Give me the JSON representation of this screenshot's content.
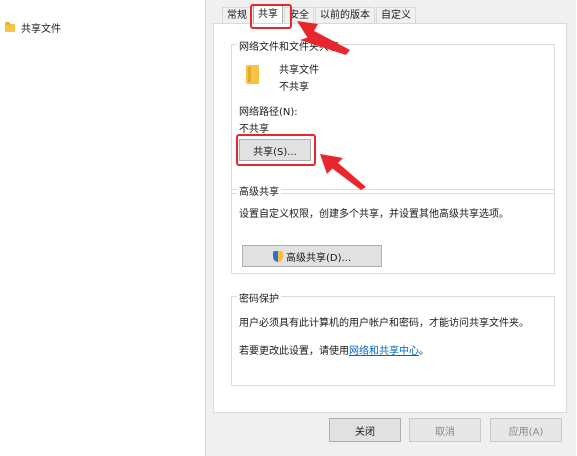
{
  "explorer": {
    "item_label": "共享文件"
  },
  "dialog": {
    "tabs": [
      {
        "label": "常规"
      },
      {
        "label": "共享"
      },
      {
        "label": "安全"
      },
      {
        "label": "以前的版本"
      },
      {
        "label": "自定义"
      }
    ],
    "network_share": {
      "group_title": "网络文件和文件夹共享",
      "folder_name": "共享文件",
      "folder_status": "不共享",
      "path_label": "网络路径(N):",
      "path_value": "不共享",
      "share_button": "共享(S)..."
    },
    "advanced_share": {
      "group_title": "高级共享",
      "description": "设置自定义权限，创建多个共享，并设置其他高级共享选项。",
      "button": "高级共享(D)..."
    },
    "password": {
      "group_title": "密码保护",
      "description": "用户必须具有此计算机的用户帐户和密码，才能访问共享文件夹。",
      "change_prefix": "若要更改此设置，请使用",
      "change_link": "网络和共享中心",
      "change_suffix": "。"
    },
    "footer": {
      "close": "关闭",
      "cancel": "取消",
      "apply": "应用(A)"
    }
  },
  "colors": {
    "annotation_red": "#e8262d",
    "link_blue": "#0066cc",
    "folder_yellow": "#f5c443"
  }
}
